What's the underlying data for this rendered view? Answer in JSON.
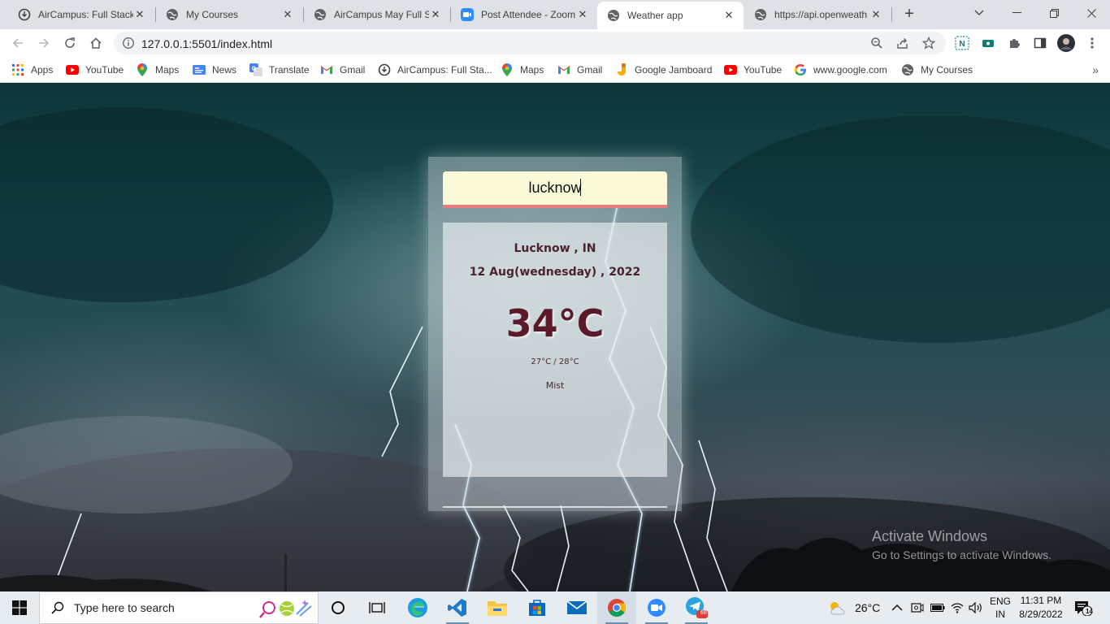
{
  "tabs": [
    {
      "title": "AirCampus: Full Stack",
      "favicon": "aircampus-icon"
    },
    {
      "title": "My Courses",
      "favicon": "globe-icon"
    },
    {
      "title": "AirCampus May Full S",
      "favicon": "globe-icon"
    },
    {
      "title": "Post Attendee - Zoom",
      "favicon": "zoom-icon"
    },
    {
      "title": "Weather app",
      "favicon": "globe-icon",
      "active": true
    },
    {
      "title": "https://api.openweath",
      "favicon": "globe-icon"
    }
  ],
  "address_bar": {
    "url": "127.0.0.1:5501/index.html"
  },
  "bookmarks": [
    {
      "label": "Apps",
      "icon": "apps-grid-icon"
    },
    {
      "label": "YouTube",
      "icon": "youtube-icon"
    },
    {
      "label": "Maps",
      "icon": "maps-pin-icon"
    },
    {
      "label": "News",
      "icon": "google-news-icon"
    },
    {
      "label": "Translate",
      "icon": "translate-icon"
    },
    {
      "label": "Gmail",
      "icon": "gmail-icon"
    },
    {
      "label": "AirCampus: Full Sta...",
      "icon": "aircampus-icon"
    },
    {
      "label": "Maps",
      "icon": "maps-pin-icon"
    },
    {
      "label": "Gmail",
      "icon": "gmail-icon"
    },
    {
      "label": "Google Jamboard",
      "icon": "jamboard-icon"
    },
    {
      "label": "YouTube",
      "icon": "youtube-icon"
    },
    {
      "label": "www.google.com",
      "icon": "google-icon"
    },
    {
      "label": "My Courses",
      "icon": "globe-icon"
    }
  ],
  "weather": {
    "search_value": "lucknow",
    "city": "Lucknow , IN",
    "date": "12 Aug(wednesday) , 2022",
    "temperature": "34°C",
    "min_max": "27°C / 28°C",
    "description": "Mist"
  },
  "watermark": {
    "line1": "Activate Windows",
    "line2": "Go to Settings to activate Windows."
  },
  "taskbar": {
    "search_placeholder": "Type here to search",
    "weather_temp": "26°C",
    "lang_line1": "ENG",
    "lang_line2": "IN",
    "time": "11:31 PM",
    "date": "8/29/2022",
    "notifications": "14",
    "telegram_badge": "68"
  },
  "colors": {
    "accent_underline": "#ea7c7c",
    "search_bg": "#fbfad8",
    "weather_text": "#5b1a2a"
  }
}
